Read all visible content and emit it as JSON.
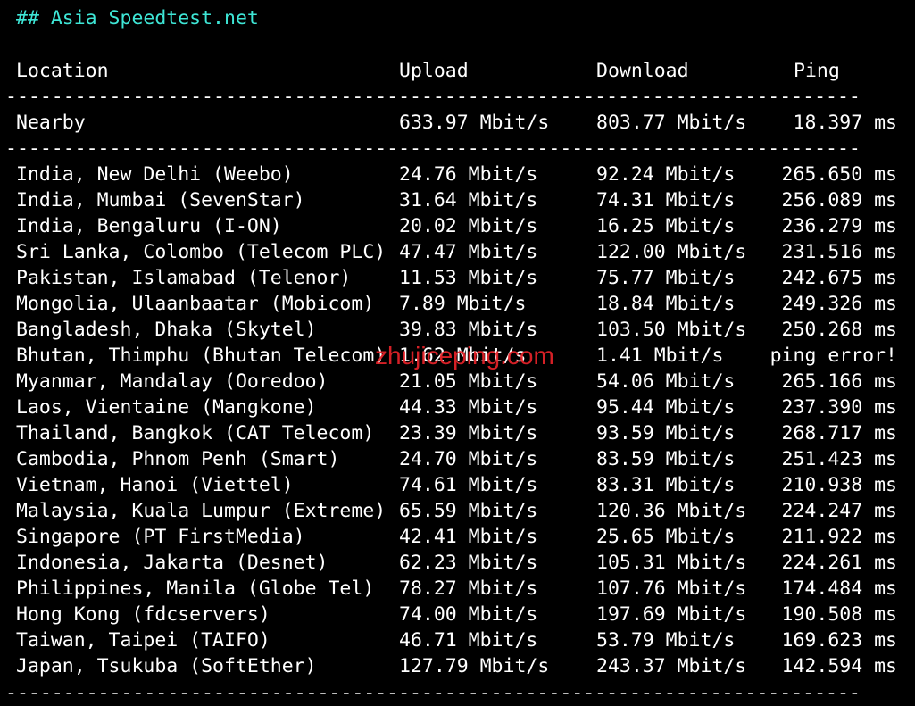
{
  "title": "## Asia Speedtest.net",
  "headers": {
    "location": "Location",
    "upload": "Upload",
    "download": "Download",
    "ping": "Ping"
  },
  "separator": "--------------------------------------------------------------------------",
  "nearby": {
    "location": "Nearby",
    "upload": "633.97 Mbit/s",
    "download": "803.77 Mbit/s",
    "ping": "18.397 ms"
  },
  "rows": [
    {
      "location": "India, New Delhi (Weebo)",
      "upload": "24.76 Mbit/s",
      "download": "92.24 Mbit/s",
      "ping": "265.650 ms"
    },
    {
      "location": "India, Mumbai (SevenStar)",
      "upload": "31.64 Mbit/s",
      "download": "74.31 Mbit/s",
      "ping": "256.089 ms"
    },
    {
      "location": "India, Bengaluru (I-ON)",
      "upload": "20.02 Mbit/s",
      "download": "16.25 Mbit/s",
      "ping": "236.279 ms"
    },
    {
      "location": "Sri Lanka, Colombo (Telecom PLC)",
      "upload": "47.47 Mbit/s",
      "download": "122.00 Mbit/s",
      "ping": "231.516 ms"
    },
    {
      "location": "Pakistan, Islamabad (Telenor)",
      "upload": "11.53 Mbit/s",
      "download": "75.77 Mbit/s",
      "ping": "242.675 ms"
    },
    {
      "location": "Mongolia, Ulaanbaatar (Mobicom)",
      "upload": "7.89 Mbit/s",
      "download": "18.84 Mbit/s",
      "ping": "249.326 ms"
    },
    {
      "location": "Bangladesh, Dhaka (Skytel)",
      "upload": "39.83 Mbit/s",
      "download": "103.50 Mbit/s",
      "ping": "250.268 ms"
    },
    {
      "location": "Bhutan, Thimphu (Bhutan Telecom)",
      "upload": "1.62 Mbit/s",
      "download": "1.41 Mbit/s",
      "ping": "ping error!"
    },
    {
      "location": "Myanmar, Mandalay (Ooredoo)",
      "upload": "21.05 Mbit/s",
      "download": "54.06 Mbit/s",
      "ping": "265.166 ms"
    },
    {
      "location": "Laos, Vientaine (Mangkone)",
      "upload": "44.33 Mbit/s",
      "download": "95.44 Mbit/s",
      "ping": "237.390 ms"
    },
    {
      "location": "Thailand, Bangkok (CAT Telecom)",
      "upload": "23.39 Mbit/s",
      "download": "93.59 Mbit/s",
      "ping": "268.717 ms"
    },
    {
      "location": "Cambodia, Phnom Penh (Smart)",
      "upload": "24.70 Mbit/s",
      "download": "83.59 Mbit/s",
      "ping": "251.423 ms"
    },
    {
      "location": "Vietnam, Hanoi (Viettel)",
      "upload": "74.61 Mbit/s",
      "download": "83.31 Mbit/s",
      "ping": "210.938 ms"
    },
    {
      "location": "Malaysia, Kuala Lumpur (Extreme)",
      "upload": "65.59 Mbit/s",
      "download": "120.36 Mbit/s",
      "ping": "224.247 ms"
    },
    {
      "location": "Singapore (PT FirstMedia)",
      "upload": "42.41 Mbit/s",
      "download": "25.65 Mbit/s",
      "ping": "211.922 ms"
    },
    {
      "location": "Indonesia, Jakarta (Desnet)",
      "upload": "62.23 Mbit/s",
      "download": "105.31 Mbit/s",
      "ping": "224.261 ms"
    },
    {
      "location": "Philippines, Manila (Globe Tel)",
      "upload": "78.27 Mbit/s",
      "download": "107.76 Mbit/s",
      "ping": "174.484 ms"
    },
    {
      "location": "Hong Kong (fdcservers)",
      "upload": "74.00 Mbit/s",
      "download": "197.69 Mbit/s",
      "ping": "190.508 ms"
    },
    {
      "location": "Taiwan, Taipei (TAIFO)",
      "upload": "46.71 Mbit/s",
      "download": "53.79 Mbit/s",
      "ping": "169.623 ms"
    },
    {
      "location": "Japan, Tsukuba (SoftEther)",
      "upload": "127.79 Mbit/s",
      "download": "243.37 Mbit/s",
      "ping": "142.594 ms"
    }
  ],
  "watermark": "zhujiceping.com",
  "colors": {
    "background": "#000000",
    "text": "#ffffff",
    "title": "#3ee6d6",
    "watermark": "#e8232a"
  }
}
